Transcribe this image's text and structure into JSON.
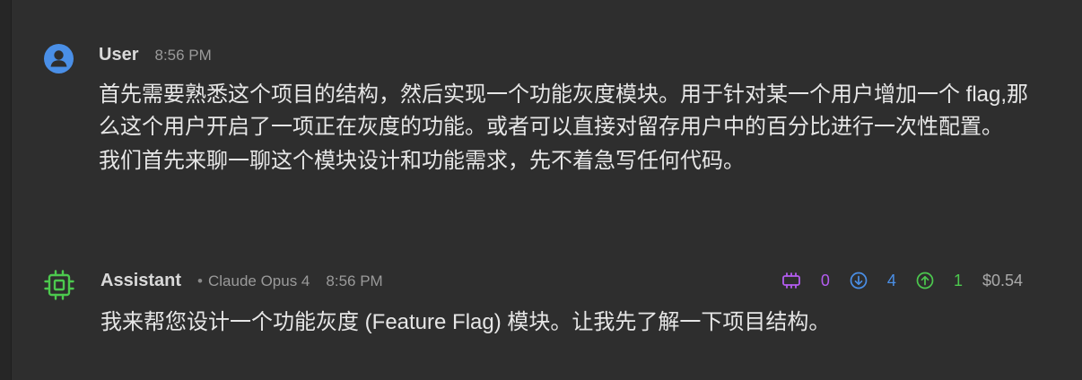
{
  "user_message": {
    "author": "User",
    "time": "8:56 PM",
    "paragraphs": [
      "首先需要熟悉这个项目的结构，然后实现一个功能灰度模块。用于针对某一个用户增加一个 flag,那么这个用户开启了一项正在灰度的功能。或者可以直接对留存用户中的百分比进行一次性配置。",
      "我们首先来聊一聊这个模块设计和功能需求，先不着急写任何代码。"
    ],
    "avatar_icon": "person-icon"
  },
  "assistant_message": {
    "author": "Assistant",
    "model": "Claude Opus 4",
    "time": "8:56 PM",
    "text": "我来帮您设计一个功能灰度 (Feature Flag) 模块。让我先了解一下项目结构。",
    "avatar_icon": "chip-icon"
  },
  "usage": {
    "cache_tokens": "0",
    "input_tokens": "4",
    "output_tokens": "1",
    "cost": "$0.54"
  },
  "colors": {
    "background": "#2e2e2e",
    "user_avatar": "#4a8fe7",
    "assistant_avatar": "#4cc94e",
    "cache": "#b45cf0",
    "input": "#4a8fe7",
    "output": "#4cc94e"
  }
}
